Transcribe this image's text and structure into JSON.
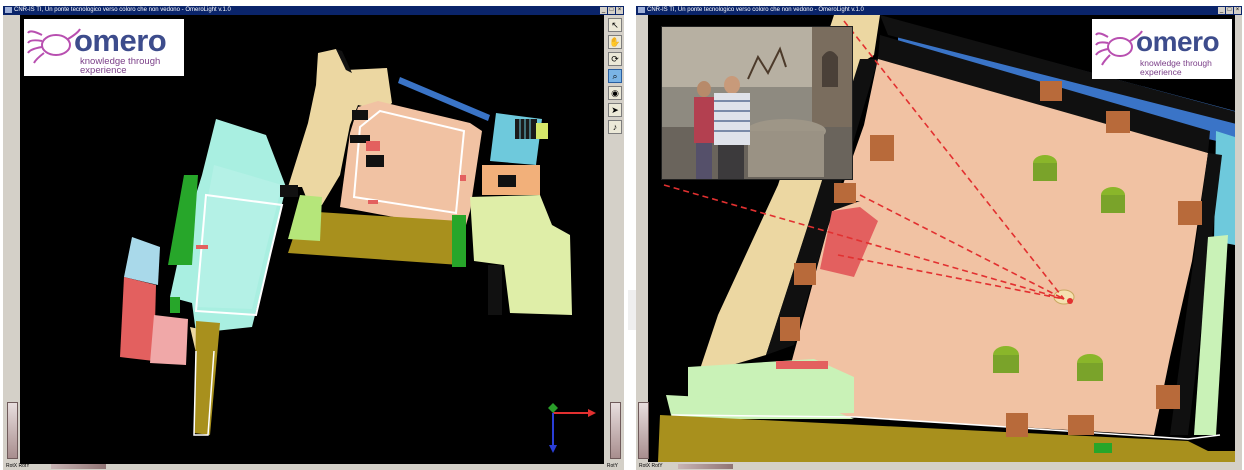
{
  "left_window": {
    "title": "CNR-IS TI, Un ponte tecnologico verso coloro che non vedono - OmeroLight v.1.0",
    "window_buttons": [
      "_",
      "□",
      "×"
    ],
    "logo": {
      "word": "omero",
      "tagline": [
        "knowledge through",
        "experience"
      ]
    },
    "toolbar": [
      {
        "icon": "pointer-icon",
        "glyph": "↖"
      },
      {
        "icon": "hand-icon",
        "glyph": "✋"
      },
      {
        "icon": "rotate-icon",
        "glyph": "⟳"
      },
      {
        "icon": "zoom-icon",
        "glyph": "⌕"
      },
      {
        "icon": "camera-icon",
        "glyph": "◉"
      },
      {
        "icon": "navigate-icon",
        "glyph": "➤"
      },
      {
        "icon": "sound-icon",
        "glyph": "♪"
      }
    ],
    "status": {
      "left": "RotX RotY",
      "right": "RotY"
    }
  },
  "right_window": {
    "title": "CNR-IS TI, Un ponte tecnologico verso coloro che non vedono - OmeroLight v.1.0",
    "window_buttons": [
      "_",
      "□",
      "×"
    ],
    "logo": {
      "word": "omero",
      "tagline": [
        "knowledge through",
        "experience"
      ]
    },
    "status": {
      "left": "RotX RotY",
      "right": ""
    }
  },
  "colors": {
    "viewport_bg": "#000000",
    "peach": "#f1c2a3",
    "tan": "#ecd7a2",
    "aqua": "#a9efe1",
    "olive": "#a8901d",
    "green": "#27a62a",
    "light_green": "#cfe89c",
    "coral": "#e3605f",
    "blue": "#3a74c7",
    "cyan": "#6ec9dc",
    "brown": "#b86a3a",
    "olive_green_column": "#7aa32a",
    "axis_red": "#e23030",
    "axis_green": "#2a9e2a",
    "axis_blue": "#2a3ed6"
  }
}
